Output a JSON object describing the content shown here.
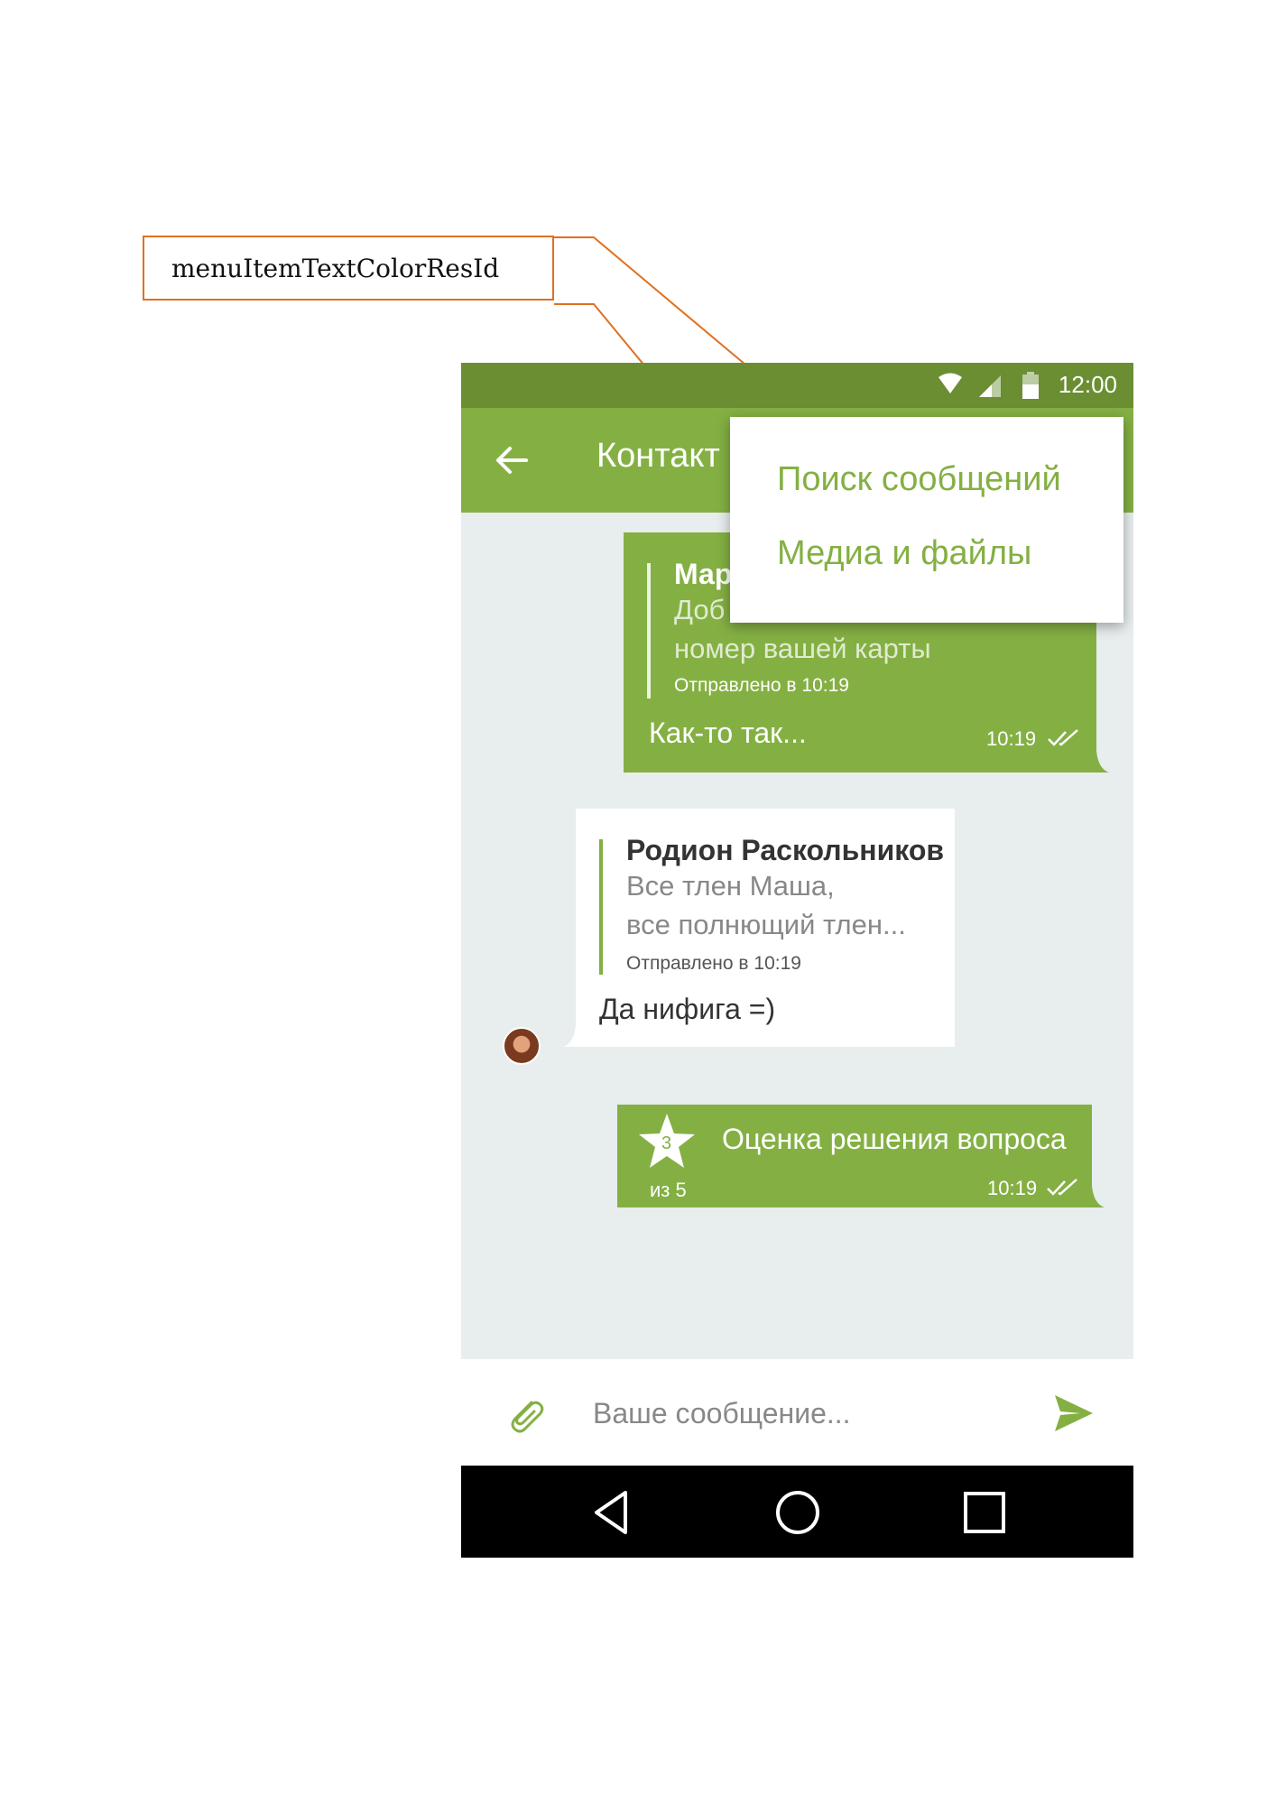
{
  "annotation": {
    "label": "menuItemTextColorResId"
  },
  "status_bar": {
    "time": "12:00"
  },
  "app_bar": {
    "title": "Контакт"
  },
  "menu": {
    "items": [
      {
        "label": "Поиск сообщений"
      },
      {
        "label": "Медиа и файлы"
      }
    ]
  },
  "messages": {
    "outgoing_1": {
      "quote_author": "Мар",
      "quote_text_line1": "Доб",
      "quote_text_line2": "номер вашей карты",
      "quote_sent": "Отправлено в 10:19",
      "text": "Как-то так...",
      "time": "10:19"
    },
    "incoming_1": {
      "quote_author": "Родион Раскольников",
      "quote_text_line1": "Все тлен Маша,",
      "quote_text_line2": "все полнющий тлен...",
      "quote_sent": "Отправлено в 10:19",
      "text": "Да нифига =)"
    },
    "rating": {
      "score": "3",
      "out_of": "из 5",
      "title": "Оценка решения вопроса",
      "time": "10:19"
    }
  },
  "composer": {
    "placeholder": "Ваше сообщение..."
  },
  "colors": {
    "primary": "#84b043",
    "primary_dark": "#6b8e33",
    "annotation": "#e07020"
  },
  "icons": [
    "back-arrow-icon",
    "wifi-icon",
    "signal-icon",
    "battery-icon",
    "double-check-icon",
    "star-icon",
    "paperclip-icon",
    "send-icon",
    "nav-back-icon",
    "nav-home-icon",
    "nav-recents-icon"
  ]
}
